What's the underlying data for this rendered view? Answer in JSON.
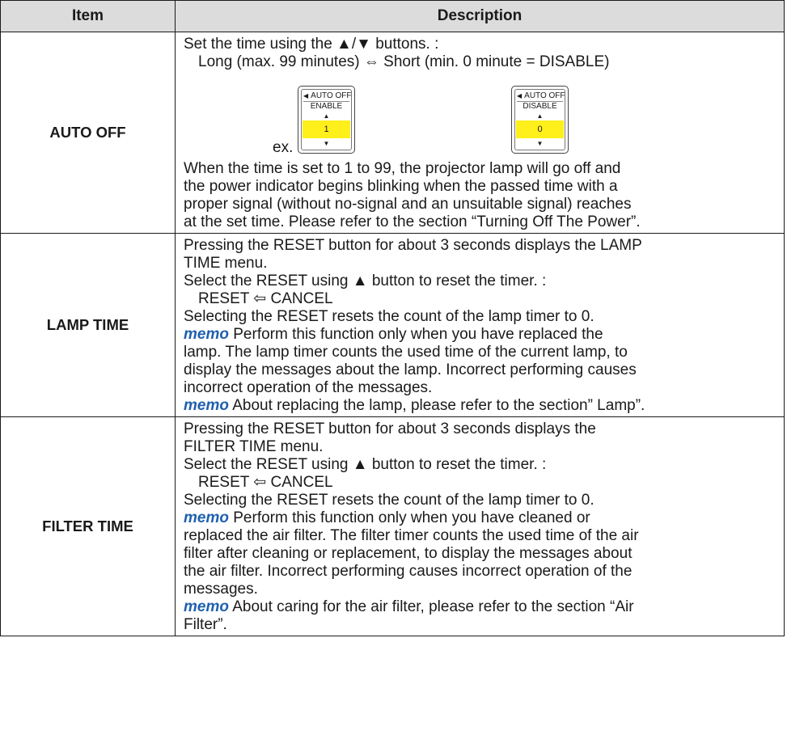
{
  "table": {
    "header": {
      "item": "Item",
      "description": "Description"
    },
    "rows": [
      {
        "item": "AUTO OFF",
        "lines": [
          "Set the time using the ▲/▼ buttons. :",
          "Long (max. 99 minutes) ⇔ Short (min. 0 minute = DISABLE)"
        ],
        "example_label": "ex.",
        "osd": [
          {
            "title": "AUTO OFF",
            "state": "ENABLE",
            "value": "1"
          },
          {
            "title": "AUTO OFF",
            "state": "DISABLE",
            "value": "0"
          }
        ],
        "after_lines": [
          "When the time is set to 1 to 99, the projector lamp will go off and",
          "the power indicator begins blinking when the passed time with a",
          "proper signal (without no-signal and an unsuitable signal) reaches",
          "at the set time. Please refer to the section “Turning Off The Power”."
        ]
      },
      {
        "item": "LAMP TIME",
        "lines": [
          "Pressing the RESET button for about 3 seconds displays the LAMP",
          "TIME menu.",
          "Select the RESET using ▲ button to reset the timer. :",
          "RESET ⇦ CANCEL",
          "Selecting the RESET resets the count of the lamp timer to 0."
        ],
        "memo1": {
          "label": "memo",
          "first": " Perform this function only when you have replaced the",
          "rest": [
            "lamp. The lamp timer counts the used time of the current lamp, to",
            "display the messages about the lamp. Incorrect performing causes",
            "incorrect operation of the messages."
          ]
        },
        "memo2": {
          "label": "memo",
          "text": " About replacing the lamp, please refer to the section” Lamp”."
        }
      },
      {
        "item": "FILTER TIME",
        "lines": [
          "Pressing the RESET button for about 3 seconds displays the",
          "FILTER TIME menu.",
          "Select the RESET using ▲ button to reset the timer. :",
          "RESET ⇦ CANCEL",
          "Selecting the RESET resets the count of the lamp timer to 0."
        ],
        "memo1": {
          "label": "memo",
          "first": " Perform this function only when you have cleaned or",
          "rest": [
            "replaced the air filter. The filter timer counts the used time of the air",
            "filter after cleaning or replacement, to display the messages about",
            "the air filter. Incorrect performing causes incorrect operation of the",
            "messages."
          ]
        },
        "memo2": {
          "label": "memo",
          "first": " About caring for the air filter, please refer to the section “Air",
          "rest": "Filter”."
        }
      }
    ]
  },
  "colors": {
    "header_bg": "#dcdcdc",
    "memo": "#1f61ae",
    "osd_highlight": "#ffef1a"
  },
  "icons": {
    "left_arrow": "left-triangle-icon",
    "up": "up-arrow-icon",
    "down": "down-arrow-icon"
  }
}
